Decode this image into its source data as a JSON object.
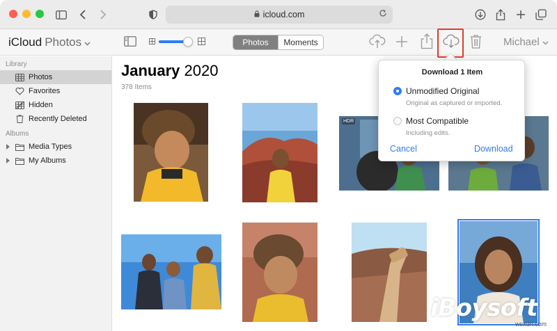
{
  "browser": {
    "url": "icloud.com"
  },
  "app": {
    "title_bold": "iCloud",
    "title_light": "Photos",
    "zoom_level": 0.92,
    "view_tabs": [
      "Photos",
      "Moments"
    ],
    "active_tab": "Photos",
    "user": "Michael"
  },
  "sidebar": {
    "library_header": "Library",
    "library_items": [
      {
        "label": "Photos",
        "icon": "photos-icon",
        "selected": true
      },
      {
        "label": "Favorites",
        "icon": "heart-icon"
      },
      {
        "label": "Hidden",
        "icon": "hidden-icon"
      },
      {
        "label": "Recently Deleted",
        "icon": "trash-icon"
      }
    ],
    "albums_header": "Albums",
    "album_items": [
      {
        "label": "Media Types",
        "icon": "folder-icon"
      },
      {
        "label": "My Albums",
        "icon": "folder-icon"
      }
    ]
  },
  "main": {
    "month": "January",
    "year": "2020",
    "item_count": "378 Items",
    "hdr_badge": "HDR"
  },
  "popover": {
    "title": "Download 1 Item",
    "option1_label": "Unmodified Original",
    "option1_desc": "Original as captured or imported.",
    "option2_label": "Most Compatible",
    "option2_desc": "Including edits.",
    "selected_option": "Unmodified Original",
    "cancel": "Cancel",
    "download": "Download"
  },
  "watermark": {
    "brand": "iBoysoft",
    "site": "wsxdn.com"
  },
  "colors": {
    "accent": "#2e7cf6",
    "highlight": "#e23a2c",
    "sidebar_bg": "#f2f2f2"
  }
}
